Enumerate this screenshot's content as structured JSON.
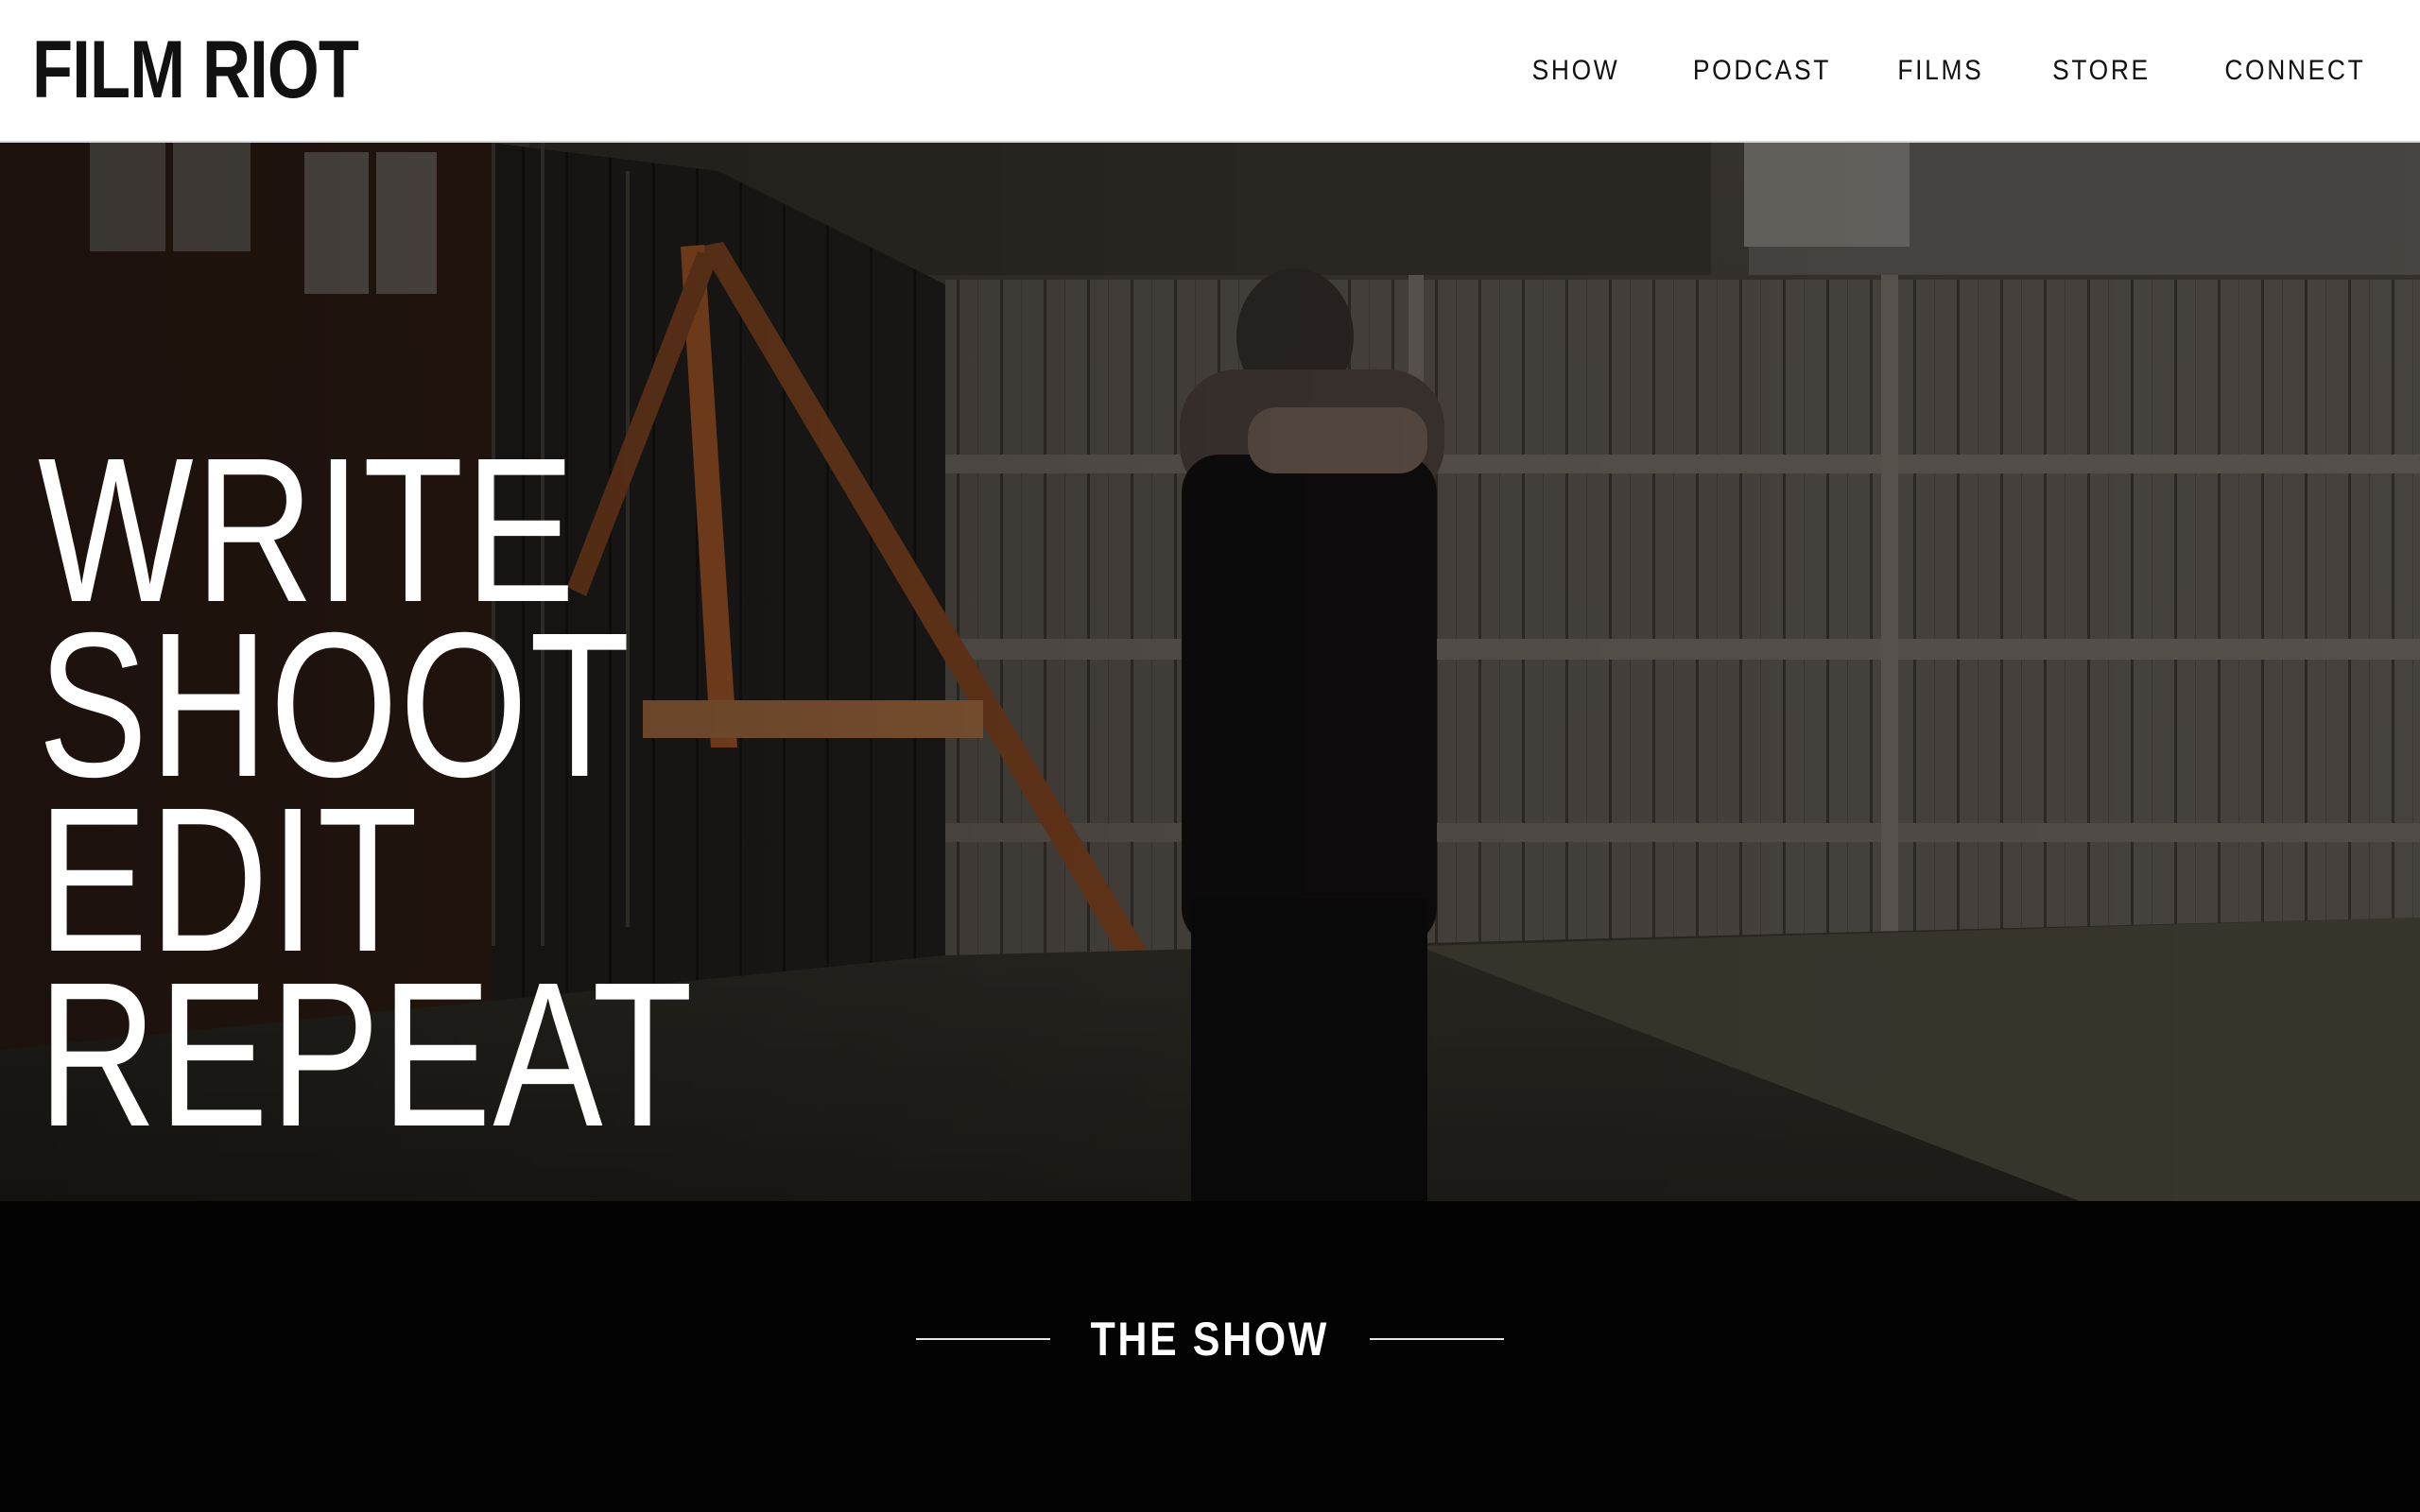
{
  "brand": {
    "logo_text": "FILM RIOT"
  },
  "nav": {
    "items": [
      {
        "label": "SHOW"
      },
      {
        "label": "PODCAST"
      },
      {
        "label": "FILMS"
      },
      {
        "label": "STORE"
      },
      {
        "label": "CONNECT"
      }
    ]
  },
  "hero": {
    "lines": [
      "WRITE",
      "SHOOT",
      "EDIT",
      "REPEAT"
    ],
    "image": "backyard-scene-man-crossing-arms"
  },
  "show": {
    "title": "THE SHOW"
  },
  "colors": {
    "header_bg": "#ffffff",
    "text_dark": "#111111",
    "section_bg": "#030303",
    "hero_text": "#ffffff"
  }
}
